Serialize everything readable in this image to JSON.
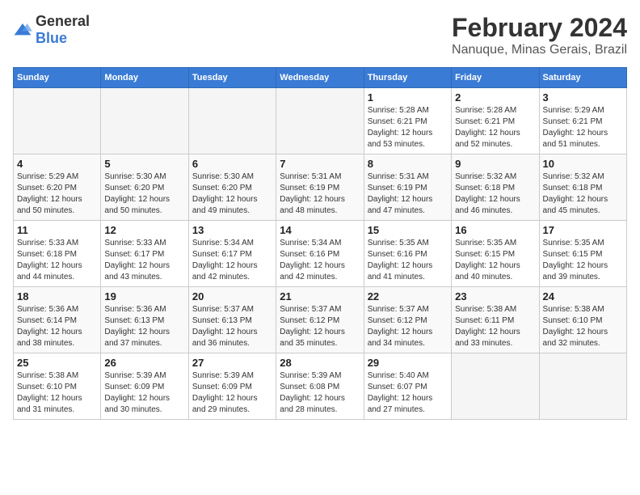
{
  "header": {
    "logo_general": "General",
    "logo_blue": "Blue",
    "main_title": "February 2024",
    "subtitle": "Nanuque, Minas Gerais, Brazil"
  },
  "calendar": {
    "days_of_week": [
      "Sunday",
      "Monday",
      "Tuesday",
      "Wednesday",
      "Thursday",
      "Friday",
      "Saturday"
    ],
    "weeks": [
      [
        {
          "day": "",
          "info": ""
        },
        {
          "day": "",
          "info": ""
        },
        {
          "day": "",
          "info": ""
        },
        {
          "day": "",
          "info": ""
        },
        {
          "day": "1",
          "info": "Sunrise: 5:28 AM\nSunset: 6:21 PM\nDaylight: 12 hours\nand 53 minutes."
        },
        {
          "day": "2",
          "info": "Sunrise: 5:28 AM\nSunset: 6:21 PM\nDaylight: 12 hours\nand 52 minutes."
        },
        {
          "day": "3",
          "info": "Sunrise: 5:29 AM\nSunset: 6:21 PM\nDaylight: 12 hours\nand 51 minutes."
        }
      ],
      [
        {
          "day": "4",
          "info": "Sunrise: 5:29 AM\nSunset: 6:20 PM\nDaylight: 12 hours\nand 50 minutes."
        },
        {
          "day": "5",
          "info": "Sunrise: 5:30 AM\nSunset: 6:20 PM\nDaylight: 12 hours\nand 50 minutes."
        },
        {
          "day": "6",
          "info": "Sunrise: 5:30 AM\nSunset: 6:20 PM\nDaylight: 12 hours\nand 49 minutes."
        },
        {
          "day": "7",
          "info": "Sunrise: 5:31 AM\nSunset: 6:19 PM\nDaylight: 12 hours\nand 48 minutes."
        },
        {
          "day": "8",
          "info": "Sunrise: 5:31 AM\nSunset: 6:19 PM\nDaylight: 12 hours\nand 47 minutes."
        },
        {
          "day": "9",
          "info": "Sunrise: 5:32 AM\nSunset: 6:18 PM\nDaylight: 12 hours\nand 46 minutes."
        },
        {
          "day": "10",
          "info": "Sunrise: 5:32 AM\nSunset: 6:18 PM\nDaylight: 12 hours\nand 45 minutes."
        }
      ],
      [
        {
          "day": "11",
          "info": "Sunrise: 5:33 AM\nSunset: 6:18 PM\nDaylight: 12 hours\nand 44 minutes."
        },
        {
          "day": "12",
          "info": "Sunrise: 5:33 AM\nSunset: 6:17 PM\nDaylight: 12 hours\nand 43 minutes."
        },
        {
          "day": "13",
          "info": "Sunrise: 5:34 AM\nSunset: 6:17 PM\nDaylight: 12 hours\nand 42 minutes."
        },
        {
          "day": "14",
          "info": "Sunrise: 5:34 AM\nSunset: 6:16 PM\nDaylight: 12 hours\nand 42 minutes."
        },
        {
          "day": "15",
          "info": "Sunrise: 5:35 AM\nSunset: 6:16 PM\nDaylight: 12 hours\nand 41 minutes."
        },
        {
          "day": "16",
          "info": "Sunrise: 5:35 AM\nSunset: 6:15 PM\nDaylight: 12 hours\nand 40 minutes."
        },
        {
          "day": "17",
          "info": "Sunrise: 5:35 AM\nSunset: 6:15 PM\nDaylight: 12 hours\nand 39 minutes."
        }
      ],
      [
        {
          "day": "18",
          "info": "Sunrise: 5:36 AM\nSunset: 6:14 PM\nDaylight: 12 hours\nand 38 minutes."
        },
        {
          "day": "19",
          "info": "Sunrise: 5:36 AM\nSunset: 6:13 PM\nDaylight: 12 hours\nand 37 minutes."
        },
        {
          "day": "20",
          "info": "Sunrise: 5:37 AM\nSunset: 6:13 PM\nDaylight: 12 hours\nand 36 minutes."
        },
        {
          "day": "21",
          "info": "Sunrise: 5:37 AM\nSunset: 6:12 PM\nDaylight: 12 hours\nand 35 minutes."
        },
        {
          "day": "22",
          "info": "Sunrise: 5:37 AM\nSunset: 6:12 PM\nDaylight: 12 hours\nand 34 minutes."
        },
        {
          "day": "23",
          "info": "Sunrise: 5:38 AM\nSunset: 6:11 PM\nDaylight: 12 hours\nand 33 minutes."
        },
        {
          "day": "24",
          "info": "Sunrise: 5:38 AM\nSunset: 6:10 PM\nDaylight: 12 hours\nand 32 minutes."
        }
      ],
      [
        {
          "day": "25",
          "info": "Sunrise: 5:38 AM\nSunset: 6:10 PM\nDaylight: 12 hours\nand 31 minutes."
        },
        {
          "day": "26",
          "info": "Sunrise: 5:39 AM\nSunset: 6:09 PM\nDaylight: 12 hours\nand 30 minutes."
        },
        {
          "day": "27",
          "info": "Sunrise: 5:39 AM\nSunset: 6:09 PM\nDaylight: 12 hours\nand 29 minutes."
        },
        {
          "day": "28",
          "info": "Sunrise: 5:39 AM\nSunset: 6:08 PM\nDaylight: 12 hours\nand 28 minutes."
        },
        {
          "day": "29",
          "info": "Sunrise: 5:40 AM\nSunset: 6:07 PM\nDaylight: 12 hours\nand 27 minutes."
        },
        {
          "day": "",
          "info": ""
        },
        {
          "day": "",
          "info": ""
        }
      ]
    ]
  }
}
